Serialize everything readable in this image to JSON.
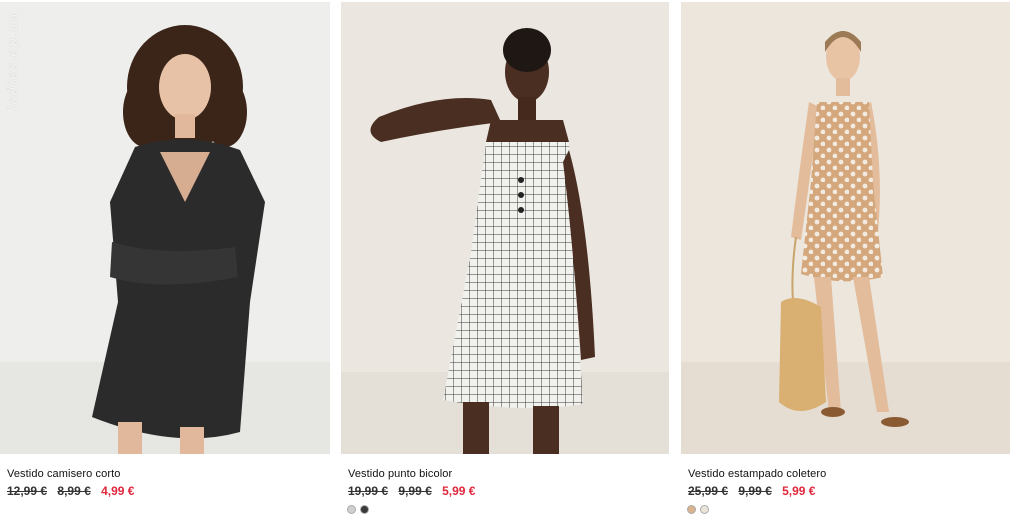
{
  "watermark": "ladies.ep.uu",
  "products": [
    {
      "name": "Vestido camisero corto",
      "old_prices": [
        "12,99 €",
        "8,99 €"
      ],
      "price": "4,99 €",
      "photo_bg": "#eeeeec",
      "swatches": []
    },
    {
      "name": "Vestido punto bicolor",
      "old_prices": [
        "19,99 €",
        "9,99 €"
      ],
      "price": "5,99 €",
      "photo_bg": "#ebe7e0",
      "swatches": [
        "#cfcfcf",
        "#3a3a3a"
      ]
    },
    {
      "name": "Vestido estampado coletero",
      "old_prices": [
        "25,99 €",
        "9,99 €"
      ],
      "price": "5,99 €",
      "photo_bg": "#ece6dd",
      "swatches": [
        "#d9b48e",
        "#e9e3d8"
      ]
    }
  ],
  "colors": {
    "sale": "#e0263b",
    "text": "#111111"
  }
}
